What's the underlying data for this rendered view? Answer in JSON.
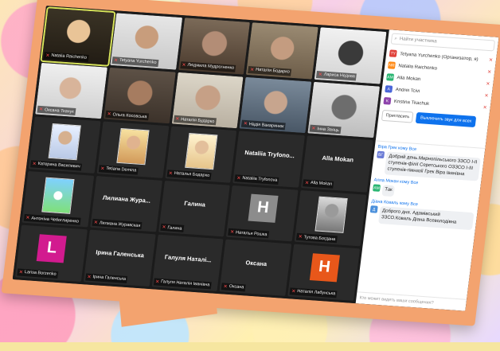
{
  "participants_panel": {
    "search_placeholder": "Найти участника",
    "items": [
      {
        "initials": "TY",
        "name": "Tetyana Yurchenko (Организатор, я)",
        "color": "#e0423b"
      },
      {
        "initials": "NR",
        "name": "Natalia Raichenko",
        "color": "#ff8c1a"
      },
      {
        "initials": "AM",
        "name": "Alla Mokan",
        "color": "#2bb673"
      },
      {
        "initials": "A",
        "name": "Andrei Tcivi",
        "color": "#4a66d9"
      },
      {
        "initials": "K",
        "name": "Kristina Tkachuk",
        "color": "#8e44ad"
      }
    ],
    "invite_label": "Пригласить",
    "mute_all_label": "Выключить звук для всех"
  },
  "chat": {
    "messages": [
      {
        "sender": "Віра Грек кому Все",
        "avatar": "ВГ",
        "avatar_color": "#6a7bd6",
        "text": "Добрий день.Мирнопільського ЗЗСО І-ІІ ступенів-філії Серетського ОЗЗСО І-ІІІ ступенів-гімназії Грек Віра Іванівна"
      },
      {
        "sender": "Алла Мокан кому Все",
        "avatar": "AM",
        "avatar_color": "#2bb673",
        "text": "Так"
      },
      {
        "sender": "Діана Коваль кому Все",
        "avatar": "Д",
        "avatar_color": "#4a8fdb",
        "text": "Доброго дня. Адамівський ЗЗСО.Коваль Діана Всеволодівна"
      }
    ],
    "input_placeholder": "Кто может видеть ваши сообщения?"
  },
  "tiles": [
    {
      "name": "Natalia Raichenko",
      "kind": "video",
      "style": "v1",
      "active": true
    },
    {
      "name": "Tetyana Yurchenko",
      "kind": "video",
      "style": "v2"
    },
    {
      "name": "Людмила Мудрогненко",
      "kind": "video",
      "style": "v3"
    },
    {
      "name": "Наталія Бодарко",
      "kind": "video",
      "style": "v4"
    },
    {
      "name": "Лариса Недова",
      "kind": "video",
      "style": "v5"
    },
    {
      "name": "Оксана Ткачук",
      "kind": "video",
      "style": "v6"
    },
    {
      "name": "Ольга Косовська",
      "kind": "video",
      "style": "v7"
    },
    {
      "name": "Наталія Бударко",
      "kind": "video",
      "style": "v8"
    },
    {
      "name": "Надія Вакаринюк",
      "kind": "video",
      "style": "v9"
    },
    {
      "name": "Інна Заяць",
      "kind": "video",
      "style": "v10"
    },
    {
      "name": "Катерина Василевич",
      "kind": "photo",
      "style": "p1"
    },
    {
      "name": "Tetiana Demina",
      "kind": "photo",
      "style": "p2"
    },
    {
      "name": "Наталья Бодарко",
      "kind": "photo",
      "style": "p3"
    },
    {
      "name": "Nataliia Tryfonova",
      "kind": "text",
      "big": "Nataliia Tryfono..."
    },
    {
      "name": "Alla Mokan",
      "kind": "text",
      "big": "Alla Mokan"
    },
    {
      "name": "Антоніна Чебоглиренко",
      "kind": "photo",
      "style": "p4"
    },
    {
      "name": "Лилиана Журавская",
      "kind": "text",
      "big": "Лилиана Жура..."
    },
    {
      "name": "Галина",
      "kind": "text",
      "big": "Галина"
    },
    {
      "name": "Наталья Рошка",
      "kind": "initial",
      "initial": "H",
      "color": "#8c8c8c"
    },
    {
      "name": "Тутова Богдана",
      "kind": "photo",
      "style": "p5"
    },
    {
      "name": "Larisa Borzenko",
      "kind": "initial",
      "initial": "L",
      "color": "#d21b8f"
    },
    {
      "name": "Ірина Галенська",
      "kind": "text",
      "big": "Ірина Галенська"
    },
    {
      "name": "Галуля Наталія Іванівна",
      "kind": "text",
      "big": "Галуля Наталі..."
    },
    {
      "name": "Оксана",
      "kind": "text",
      "big": "Оксана"
    },
    {
      "name": "Наталія Лабунська",
      "kind": "initial",
      "initial": "H",
      "color": "#e8571a"
    }
  ]
}
